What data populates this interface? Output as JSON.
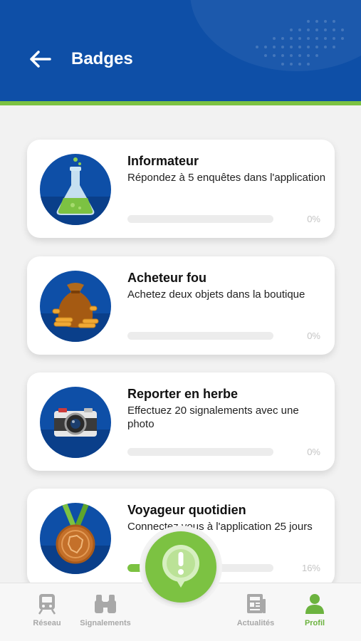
{
  "header": {
    "title": "Badges",
    "bg_color": "#0e4fa7",
    "accent_line_color": "#7cc242"
  },
  "badges": [
    {
      "title": "Informateur",
      "description": "Répondez à 5 enquêtes dans l'application",
      "progress_label": "0%",
      "progress": 0,
      "icon": "flask-icon"
    },
    {
      "title": "Acheteur fou",
      "description": "Achetez deux objets dans la boutique",
      "progress_label": "0%",
      "progress": 0,
      "icon": "money-bag-icon"
    },
    {
      "title": "Reporter en herbe",
      "description": "Effectuez 20 signalements avec une photo",
      "progress_label": "0%",
      "progress": 0,
      "icon": "camera-icon"
    },
    {
      "title": "Voyageur quotidien",
      "description": "Connectez vous à l'application 25 jours",
      "progress_label": "16%",
      "progress": 0.16,
      "icon": "medal-icon"
    }
  ],
  "tabbar": {
    "items": [
      {
        "label": "Réseau",
        "icon": "train-icon",
        "active": false
      },
      {
        "label": "Signalements",
        "icon": "binoculars-icon",
        "active": false
      },
      {
        "label": "Actualités",
        "icon": "newspaper-icon",
        "active": false
      },
      {
        "label": "Profil",
        "icon": "person-icon",
        "active": true
      }
    ],
    "active_color": "#6cb33f",
    "inactive_color": "#a8a8a8"
  },
  "fab": {
    "icon": "exclamation-icon",
    "color": "#7cc242"
  }
}
